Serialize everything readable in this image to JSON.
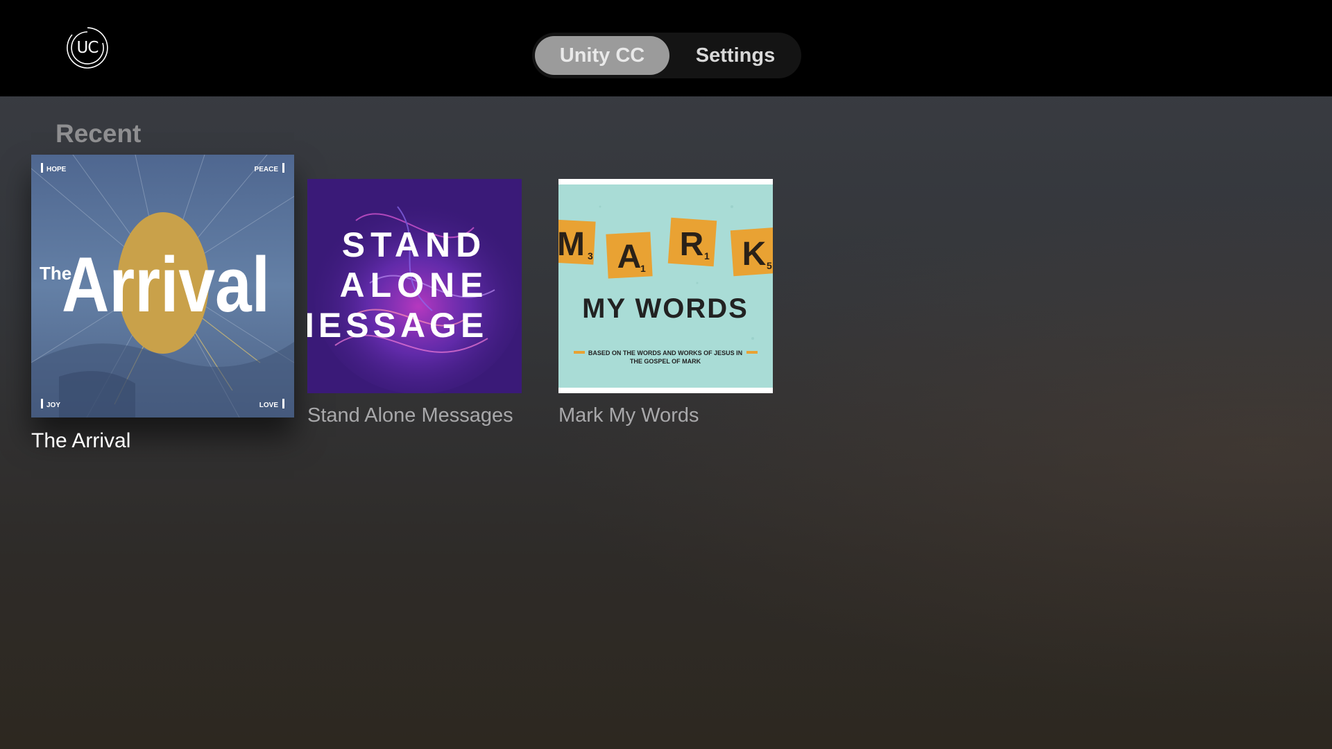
{
  "app": {
    "logo_text": "UC"
  },
  "tabs": [
    {
      "label": "Unity CC",
      "selected": true
    },
    {
      "label": "Settings",
      "selected": false
    }
  ],
  "section": {
    "title": "Recent"
  },
  "cards": [
    {
      "title": "The Arrival",
      "focused": true,
      "art": {
        "word_the": "The",
        "word_main": "Arrival",
        "corner_tl": "HOPE",
        "corner_tr": "PEACE",
        "corner_bl": "JOY",
        "corner_br": "LOVE"
      }
    },
    {
      "title": "Stand Alone Messages",
      "focused": false,
      "art": {
        "line1": "STAND",
        "line2": "ALONE",
        "line3": "IESSAGE"
      }
    },
    {
      "title": "Mark My Words",
      "focused": false,
      "art": {
        "tile1": "M",
        "tile1_sub": "3",
        "tile2": "A",
        "tile2_sub": "1",
        "tile3": "R",
        "tile3_sub": "1",
        "tile4": "K",
        "tile4_sub": "5",
        "subtitle": "MY WORDS",
        "tagline1": "BASED ON THE WORDS AND WORKS OF JESUS IN",
        "tagline2": "THE GOSPEL OF MARK"
      }
    }
  ],
  "colors": {
    "topbar": "#000000",
    "tab_selected_bg": "#9b9b9b",
    "arrival_bg": "#5a7196",
    "arrival_sun": "#c9a14a",
    "standalone_bg": "#3a1a78",
    "mark_bg": "#a9dcd6",
    "mark_tile": "#e9a233"
  }
}
